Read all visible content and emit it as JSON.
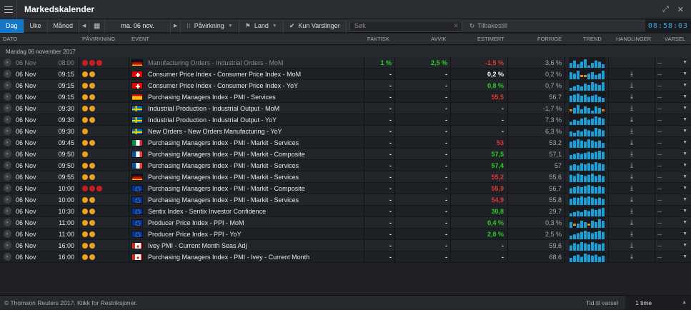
{
  "app": {
    "title": "Markedskalender",
    "clock": "08:58:03"
  },
  "toolbar": {
    "tabs": [
      {
        "label": "Dag",
        "active": true
      },
      {
        "label": "Uke",
        "active": false
      },
      {
        "label": "Måned",
        "active": false
      }
    ],
    "date": "ma. 06 nov.",
    "impact_label": "Påvirkning",
    "country_label": "Land",
    "alerts_label": "Kun Varslinger",
    "search_placeholder": "Søk",
    "reset_label": "Tilbakestill"
  },
  "columns": {
    "date": "DATO",
    "impact": "PÅVIRKNING",
    "event": "EVENT",
    "actual": "FAKTISK",
    "deviation": "AVVIK",
    "estimate": "ESTIMERT",
    "previous": "FORRIGE",
    "trend": "TREND",
    "actions": "HANDLINGER",
    "alert": "VARSEL"
  },
  "group_label": "Mandag 06 november 2017",
  "rows": [
    {
      "date": "06 Nov",
      "time": "08:00",
      "impact": 3,
      "flag": "de",
      "event": "Manufacturing Orders - Industrial Orders - MoM",
      "actual": "1 %",
      "deviation": "2,5 %",
      "estimate": "-1,5 %",
      "previous": "3,6 %",
      "past": true,
      "trend": [
        4,
        6,
        3,
        5,
        7,
        2,
        4,
        6,
        5,
        3
      ]
    },
    {
      "date": "06 Nov",
      "time": "09:15",
      "impact": 2,
      "flag": "ch",
      "event": "Consumer Price Index - Consumer Price Index - MoM",
      "actual": "-",
      "deviation": "-",
      "estimate": "0,2 %",
      "previous": "0,2 %",
      "trend": [
        5,
        4,
        6,
        -2,
        -3,
        4,
        5,
        3,
        4,
        6
      ]
    },
    {
      "date": "06 Nov",
      "time": "09:15",
      "impact": 2,
      "flag": "ch",
      "event": "Consumer Price Index - Consumer Price Index - YoY",
      "actual": "-",
      "deviation": "-",
      "estimate": "0,8 %",
      "previous": "0,7 %",
      "trend": [
        2,
        3,
        4,
        3,
        5,
        4,
        6,
        5,
        4,
        6
      ]
    },
    {
      "date": "06 Nov",
      "time": "09:15",
      "impact": 2,
      "flag": "es",
      "event": "Purchasing Managers Index - PMI - Services",
      "actual": "-",
      "deviation": "-",
      "estimate": "55,5",
      "previous": "56,7",
      "trend": [
        6,
        7,
        8,
        6,
        7,
        5,
        6,
        7,
        5,
        4
      ]
    },
    {
      "date": "06 Nov",
      "time": "09:30",
      "impact": 2,
      "flag": "se",
      "event": "Industrial Production - Industrial Output - MoM",
      "actual": "-",
      "deviation": "-",
      "estimate": "-",
      "previous": "-1,7 %",
      "trend": [
        -3,
        4,
        6,
        3,
        5,
        4,
        2,
        5,
        4,
        -2
      ]
    },
    {
      "date": "06 Nov",
      "time": "09:30",
      "impact": 2,
      "flag": "se",
      "event": "Industrial Production - Industrial Output - YoY",
      "actual": "-",
      "deviation": "-",
      "estimate": "-",
      "previous": "7,3 %",
      "trend": [
        3,
        5,
        4,
        6,
        7,
        5,
        6,
        8,
        7,
        6
      ]
    },
    {
      "date": "06 Nov",
      "time": "09:30",
      "impact": 1,
      "flag": "se",
      "event": "New Orders - New Orders Manufacturing - YoY",
      "actual": "-",
      "deviation": "-",
      "estimate": "-",
      "previous": "6,3 %",
      "trend": [
        4,
        3,
        5,
        4,
        6,
        5,
        4,
        7,
        6,
        5
      ]
    },
    {
      "date": "06 Nov",
      "time": "09:45",
      "impact": 2,
      "flag": "it",
      "event": "Purchasing Managers Index - PMI - Markit - Services",
      "actual": "-",
      "deviation": "-",
      "estimate": "53",
      "previous": "53,2",
      "trend": [
        5,
        6,
        7,
        6,
        5,
        7,
        6,
        5,
        6,
        4
      ]
    },
    {
      "date": "06 Nov",
      "time": "09:50",
      "impact": 1,
      "flag": "fr",
      "event": "Purchasing Managers Index - PMI - Markit - Composite",
      "actual": "-",
      "deviation": "-",
      "estimate": "57,5",
      "previous": "57,1",
      "trend": [
        4,
        5,
        6,
        5,
        6,
        7,
        6,
        7,
        8,
        7
      ]
    },
    {
      "date": "06 Nov",
      "time": "09:50",
      "impact": 2,
      "flag": "fr",
      "event": "Purchasing Managers Index - PMI - Markit - Services",
      "actual": "-",
      "deviation": "-",
      "estimate": "57,4",
      "previous": "57",
      "trend": [
        5,
        6,
        5,
        7,
        6,
        7,
        6,
        8,
        7,
        6
      ]
    },
    {
      "date": "06 Nov",
      "time": "09:55",
      "impact": 2,
      "flag": "de",
      "event": "Purchasing Managers Index - PMI - Markit - Services",
      "actual": "-",
      "deviation": "-",
      "estimate": "55,2",
      "previous": "55,6",
      "trend": [
        6,
        5,
        7,
        6,
        5,
        6,
        7,
        5,
        6,
        5
      ]
    },
    {
      "date": "06 Nov",
      "time": "10:00",
      "impact": 3,
      "flag": "eu",
      "event": "Purchasing Managers Index - PMI - Markit - Composite",
      "actual": "-",
      "deviation": "-",
      "estimate": "55,9",
      "previous": "56,7",
      "trend": [
        5,
        6,
        7,
        6,
        7,
        8,
        7,
        6,
        7,
        6
      ]
    },
    {
      "date": "06 Nov",
      "time": "10:00",
      "impact": 2,
      "flag": "eu",
      "event": "Purchasing Managers Index - PMI - Markit - Services",
      "actual": "-",
      "deviation": "-",
      "estimate": "54,9",
      "previous": "55,8",
      "trend": [
        5,
        6,
        6,
        7,
        6,
        7,
        6,
        5,
        6,
        5
      ]
    },
    {
      "date": "06 Nov",
      "time": "10:30",
      "impact": 2,
      "flag": "eu",
      "event": "Sentix Index - Sentix Investor Confidence",
      "actual": "-",
      "deviation": "-",
      "estimate": "30,8",
      "previous": "29,7",
      "trend": [
        3,
        4,
        5,
        4,
        6,
        5,
        7,
        6,
        7,
        8
      ]
    },
    {
      "date": "06 Nov",
      "time": "11:00",
      "impact": 2,
      "flag": "eu",
      "event": "Producer Price Index - PPI - MoM",
      "actual": "-",
      "deviation": "-",
      "estimate": "0,4 %",
      "previous": "0,3 %",
      "trend": [
        4,
        -2,
        3,
        5,
        4,
        -3,
        5,
        4,
        6,
        5
      ]
    },
    {
      "date": "06 Nov",
      "time": "11:00",
      "impact": 2,
      "flag": "eu",
      "event": "Producer Price Index - PPI - YoY",
      "actual": "-",
      "deviation": "-",
      "estimate": "2,8 %",
      "previous": "2,5 %",
      "trend": [
        3,
        4,
        5,
        6,
        7,
        6,
        5,
        6,
        7,
        6
      ]
    },
    {
      "date": "06 Nov",
      "time": "16:00",
      "impact": 2,
      "flag": "ca",
      "event": "Ivey PMI - Current Month Seas Adj",
      "actual": "-",
      "deviation": "-",
      "estimate": "-",
      "previous": "59,6",
      "trend": [
        5,
        7,
        6,
        8,
        7,
        6,
        8,
        7,
        6,
        7
      ]
    },
    {
      "date": "06 Nov",
      "time": "16:00",
      "impact": 2,
      "flag": "ca",
      "event": "Purchasing Managers Index - PMI - Ivey - Current Month",
      "actual": "-",
      "deviation": "-",
      "estimate": "-",
      "previous": "68,6",
      "trend": [
        4,
        6,
        7,
        5,
        8,
        7,
        6,
        7,
        5,
        6
      ]
    }
  ],
  "footer": {
    "copyright": "© Thomson Reuters 2017. Klikk for Restriksjoner.",
    "alert_time_label": "Tid til varsel",
    "alert_time_value": "1 time"
  },
  "colors": {
    "accent": "#1478c8",
    "impact": "#f0a020",
    "impact_high": "#c81e1e",
    "positive": "#26d21e",
    "negative": "#e23434",
    "trend": "#1aa0d8",
    "trend_neg": "#e08a1a"
  }
}
